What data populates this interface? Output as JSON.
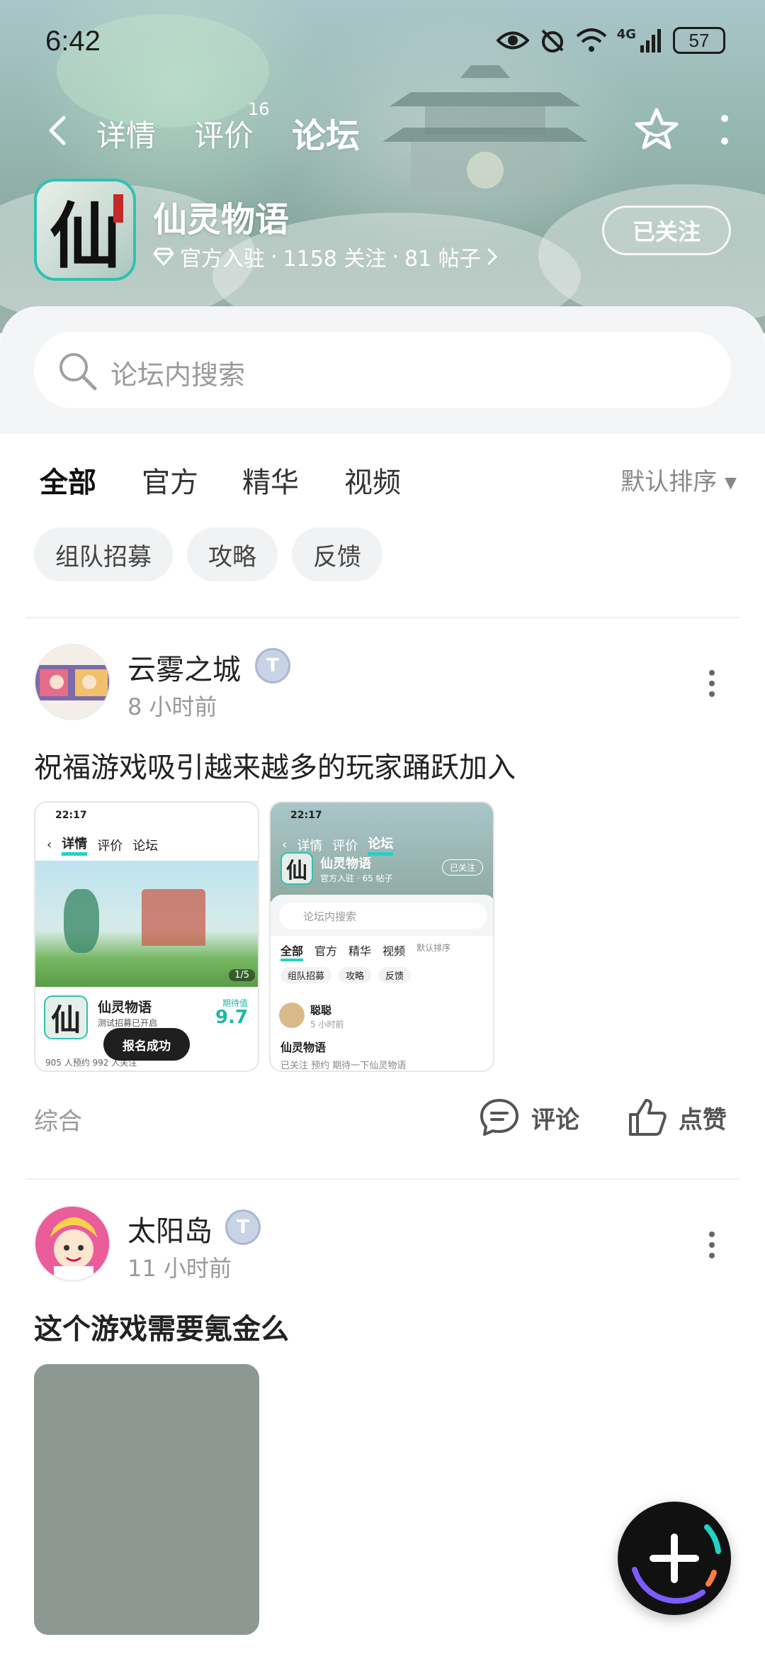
{
  "status_bar": {
    "time": "6:42",
    "network": "4G",
    "battery": "57"
  },
  "nav": {
    "tabs": [
      {
        "label": "详情",
        "active": false
      },
      {
        "label": "评价",
        "badge": "16",
        "active": false
      },
      {
        "label": "论坛",
        "active": true
      }
    ]
  },
  "app": {
    "name": "仙灵物语",
    "icon_glyph": "仙",
    "official": "官方入驻",
    "followers": "1158 关注",
    "posts": "81 帖子",
    "follow_label": "已关注"
  },
  "search": {
    "placeholder": "论坛内搜索"
  },
  "filter_tabs": [
    {
      "label": "全部",
      "active": true
    },
    {
      "label": "官方",
      "active": false
    },
    {
      "label": "精华",
      "active": false
    },
    {
      "label": "视频",
      "active": false
    }
  ],
  "sort_label": "默认排序",
  "chips": [
    "组队招募",
    "攻略",
    "反馈"
  ],
  "posts": [
    {
      "author": "云雾之城",
      "time": "8 小时前",
      "text": "祝福游戏吸引越来越多的玩家踊跃加入",
      "category": "综合",
      "comment_label": "评论",
      "like_label": "点赞",
      "images": [
        {
          "status_time": "22:17",
          "tabs": [
            "详情",
            "评价",
            "论坛"
          ],
          "banner_counter": "1/5",
          "app_name": "仙灵物语",
          "app_sub": "测试招募已开启",
          "score_label": "期待值",
          "score": "9.7",
          "toast": "报名成功",
          "stats": "905 人预约   992 人关注"
        },
        {
          "status_time": "22:17",
          "tabs": [
            "详情",
            "评价",
            "论坛"
          ],
          "app_name": "仙灵物语",
          "app_meta": "官方入驻 · 65 帖子",
          "follow": "已关注",
          "search": "论坛内搜索",
          "ftabs": [
            "全部",
            "官方",
            "精华",
            "视频"
          ],
          "sort": "默认排序",
          "chips": [
            "组队招募",
            "攻略",
            "反馈"
          ],
          "user": "聪聪",
          "user_time": "5 小时前",
          "post_title": "仙灵物语",
          "post_line": "已关注   预约   期待一下仙灵物语"
        }
      ]
    },
    {
      "author": "太阳岛",
      "time": "11 小时前",
      "text": "这个游戏需要氪金么"
    }
  ],
  "colors": {
    "accent": "#22d3c5",
    "icon_border": "#2fc2b0",
    "placeholder_image": "#8e9893"
  }
}
